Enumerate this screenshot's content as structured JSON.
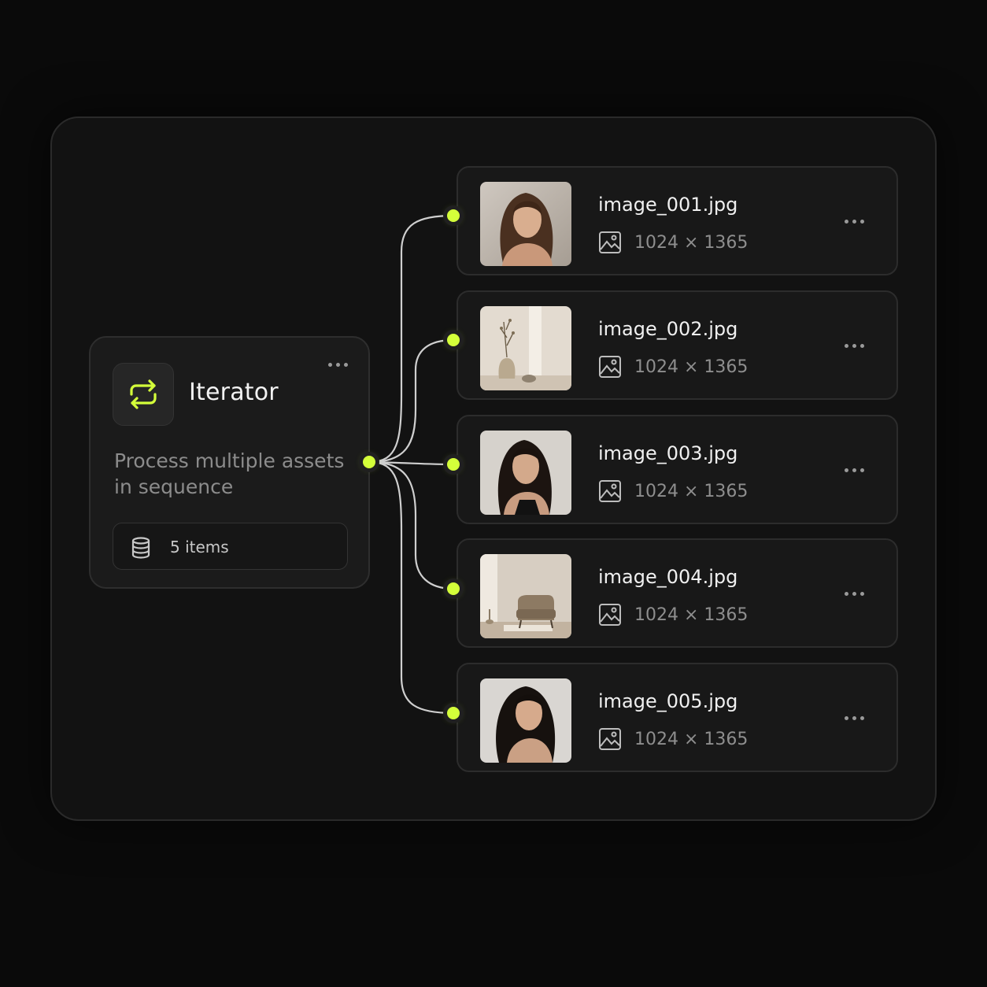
{
  "accent_color": "#d4ff3a",
  "iterator": {
    "icon": "repeat-icon",
    "title": "Iterator",
    "description": "Process multiple assets in sequence",
    "items_icon": "database-icon",
    "items_count_label": "5 items",
    "menu_icon": "more-horizontal-icon"
  },
  "assets": [
    {
      "name": "image_001.jpg",
      "dimensions": "1024 × 1365",
      "thumbnail": "portrait-woman",
      "type_icon": "image-icon",
      "menu_icon": "more-horizontal-icon"
    },
    {
      "name": "image_002.jpg",
      "dimensions": "1024 × 1365",
      "thumbnail": "still-life-vase",
      "type_icon": "image-icon",
      "menu_icon": "more-horizontal-icon"
    },
    {
      "name": "image_003.jpg",
      "dimensions": "1024 × 1365",
      "thumbnail": "portrait-woman",
      "type_icon": "image-icon",
      "menu_icon": "more-horizontal-icon"
    },
    {
      "name": "image_004.jpg",
      "dimensions": "1024 × 1365",
      "thumbnail": "interior-armchair",
      "type_icon": "image-icon",
      "menu_icon": "more-horizontal-icon"
    },
    {
      "name": "image_005.jpg",
      "dimensions": "1024 × 1365",
      "thumbnail": "portrait-woman",
      "type_icon": "image-icon",
      "menu_icon": "more-horizontal-icon"
    }
  ]
}
